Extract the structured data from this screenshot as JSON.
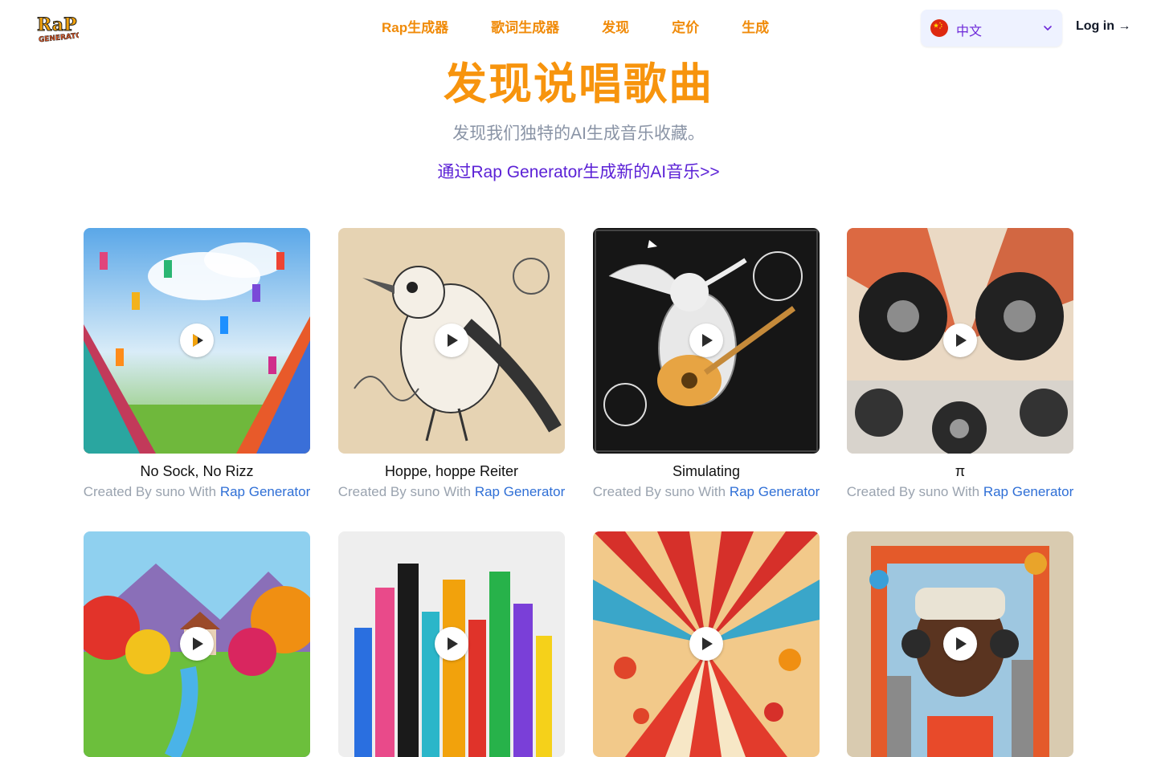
{
  "header": {
    "logo_text": "Rap Generator",
    "nav": [
      {
        "label": "Rap生成器"
      },
      {
        "label": "歌词生成器"
      },
      {
        "label": "发现"
      },
      {
        "label": "定价"
      },
      {
        "label": "生成"
      }
    ],
    "language": {
      "label": "中文",
      "flag": "china-flag-icon"
    },
    "login": "Log in →"
  },
  "hero": {
    "title": "发现说唱歌曲",
    "subtitle": "发现我们独特的AI生成音乐收藏。",
    "cta": "通过Rap Generator生成新的AI音乐>>"
  },
  "cards": [
    {
      "title": "No Sock, No Rizz",
      "credit_prefix": "Created By suno With ",
      "credit_link": "Rap Generator"
    },
    {
      "title": "Hoppe, hoppe Reiter",
      "credit_prefix": "Created By suno With ",
      "credit_link": "Rap Generator"
    },
    {
      "title": "Simulating",
      "credit_prefix": "Created By suno With ",
      "credit_link": "Rap Generator"
    },
    {
      "title": "π",
      "credit_prefix": "Created By suno With ",
      "credit_link": "Rap Generator"
    },
    {
      "title": "",
      "credit_prefix": "",
      "credit_link": ""
    },
    {
      "title": "",
      "credit_prefix": "",
      "credit_link": ""
    },
    {
      "title": "",
      "credit_prefix": "",
      "credit_link": ""
    },
    {
      "title": "",
      "credit_prefix": "",
      "credit_link": ""
    }
  ],
  "colors": {
    "brand_orange": "#f7940d",
    "cta_purple": "#5b21d6",
    "link_blue": "#2f6fd6",
    "muted_gray": "#9aa3af"
  }
}
